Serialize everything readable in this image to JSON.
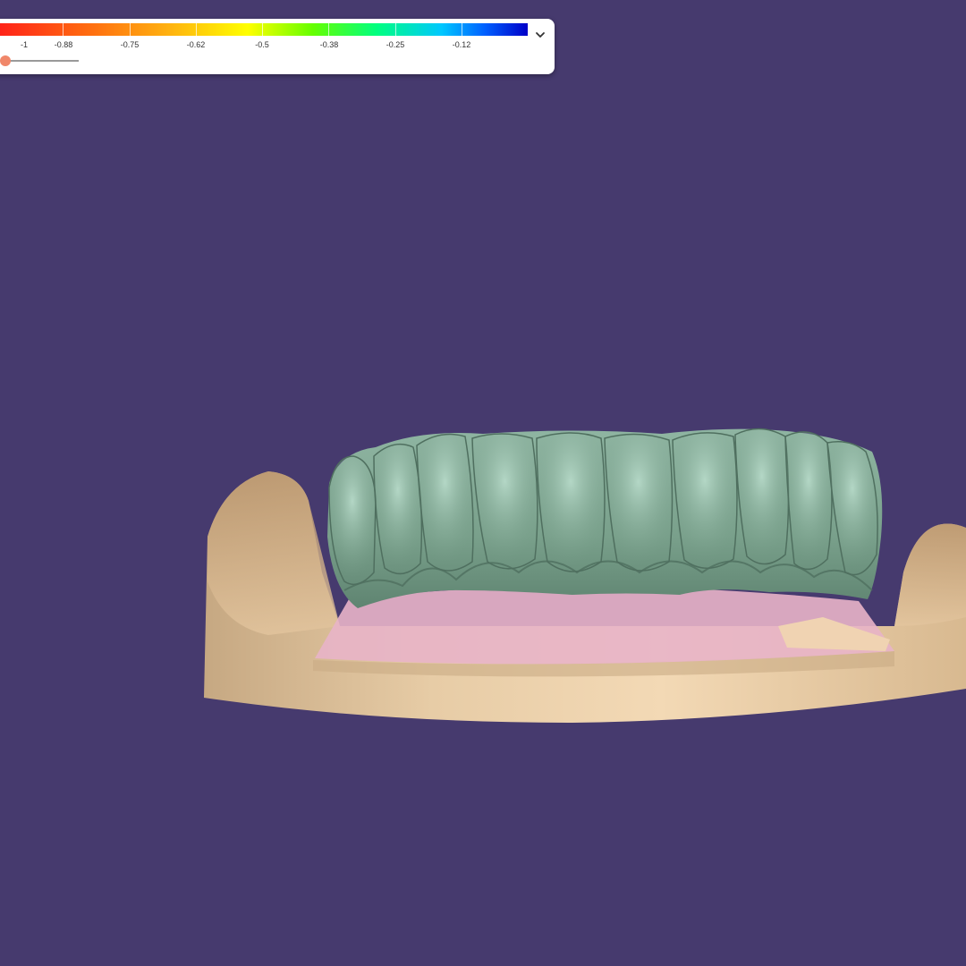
{
  "legend": {
    "ticks": [
      "-1",
      "-0.88",
      "-0.75",
      "-0.62",
      "-0.5",
      "-0.38",
      "-0.25",
      "-0.12"
    ],
    "slider_value": 0,
    "colors": {
      "min": "#ff1a1a",
      "max": "#0000c8"
    }
  },
  "viewport": {
    "background": "#463a6e",
    "model_colors": {
      "teeth": "#7fa38f",
      "gingiva": "#e8b4c8",
      "stone_model": "#e4c6a0"
    }
  }
}
